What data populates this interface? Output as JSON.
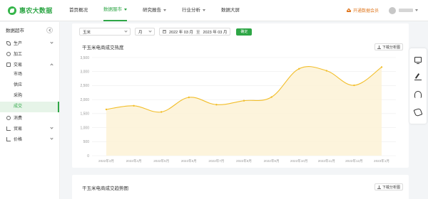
{
  "app": {
    "logo_text": "惠农大数据",
    "nav": [
      {
        "label": "首页概况",
        "active": false,
        "has_dropdown": false
      },
      {
        "label": "数据服市",
        "active": true,
        "has_dropdown": true
      },
      {
        "label": "研究报告",
        "active": false,
        "has_dropdown": true
      },
      {
        "label": "行业分析",
        "active": false,
        "has_dropdown": true
      },
      {
        "label": "数据大屏",
        "active": false,
        "has_dropdown": false
      }
    ],
    "vip_label": "开通数据会员",
    "accent_color": "#2ea646",
    "vip_color": "#e07a24"
  },
  "sidebar": {
    "title": "数据超市",
    "items": [
      {
        "label": "生产",
        "icon": "leaf-icon",
        "expandable": true
      },
      {
        "label": "加工",
        "icon": "factory-icon",
        "expandable": false
      },
      {
        "label": "交易",
        "icon": "exchange-icon",
        "expandable": true
      }
    ],
    "trade_sub": [
      {
        "label": "市场",
        "active": false
      },
      {
        "label": "供应",
        "active": false
      },
      {
        "label": "采购",
        "active": false
      },
      {
        "label": "成交",
        "active": true
      }
    ],
    "items_after": [
      {
        "label": "消费",
        "icon": "consume-icon",
        "expandable": false
      },
      {
        "label": "贸易",
        "icon": "cart-icon",
        "expandable": true
      },
      {
        "label": "价格",
        "icon": "price-icon",
        "expandable": true
      }
    ]
  },
  "filters": {
    "product": "玉米",
    "period": "月",
    "start_date": "2022 年 03 月",
    "date_separator": "至",
    "end_date": "2023 年 03 月",
    "query_label": "确定"
  },
  "panel1": {
    "title": "干玉米电商成交热度",
    "download_label": "下载分析图"
  },
  "panel2": {
    "title": "干玉米电商成交趋势图",
    "download_label": "下载分析图"
  },
  "chart_data": {
    "type": "area",
    "title": "干玉米电商成交热度",
    "xlabel": "",
    "ylabel": "",
    "categories": [
      "2022年3月",
      "2022年4月",
      "2022年5月",
      "2022年6月",
      "2022年7月",
      "2022年8月",
      "2022年9月",
      "2022年10月",
      "2022年11月",
      "2022年12月",
      "2023年1月"
    ],
    "values": [
      1650,
      1780,
      1560,
      2080,
      1820,
      1960,
      2090,
      3100,
      3030,
      2510,
      3160
    ],
    "yticks": [
      0,
      500,
      1000,
      1500,
      2000,
      2500,
      3000,
      3500
    ],
    "ylim": [
      0,
      3500
    ],
    "grid": true,
    "line_color": "#f2be2a",
    "fill_color": "#fdf3d8"
  },
  "float_toolbar": [
    {
      "name": "monitor-icon"
    },
    {
      "name": "edit-icon"
    },
    {
      "name": "headset-icon"
    },
    {
      "name": "phone-icon"
    }
  ]
}
